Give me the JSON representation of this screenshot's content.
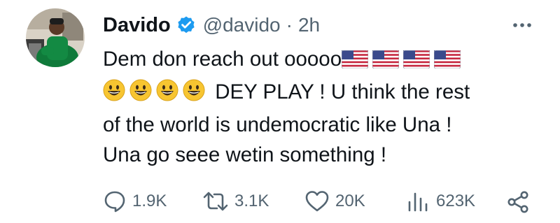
{
  "tweet": {
    "author": {
      "display_name": "Davido",
      "handle": "@davido",
      "verified": true,
      "separator": "·",
      "time": "2h"
    },
    "body": {
      "line1_text": "Dem don reach out ooooo",
      "line1_emoji": [
        "us-flag-emoji",
        "us-flag-emoji",
        "us-flag-emoji",
        "us-flag-emoji"
      ],
      "line2_emoji": [
        "grinning-face-emoji",
        "grinning-face-emoji",
        "grinning-face-emoji",
        "grinning-face-emoji"
      ],
      "line2_text": "DEY PLAY ! U think the rest",
      "line3_text": "of the world is undemocratic like Una !",
      "line4_text": "Una go seee wetin something !"
    },
    "actions": {
      "replies": "1.9K",
      "reposts": "3.1K",
      "likes": "20K",
      "views": "623K"
    },
    "colors": {
      "text": "#0f1419",
      "secondary": "#536471",
      "verified_badge": "#1d9bf0"
    }
  }
}
